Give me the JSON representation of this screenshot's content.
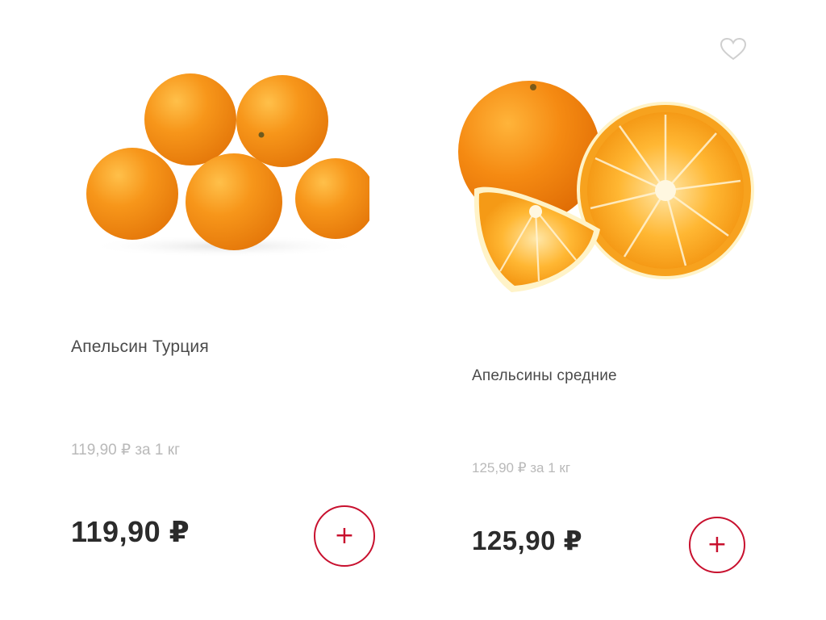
{
  "products": [
    {
      "name": "Апельсин Турция",
      "unit_price": "119,90 ₽ за 1 кг",
      "price": "119,90 ₽",
      "image_icon": "oranges-pile-image",
      "add_icon_glyph": "+"
    },
    {
      "name": "Апельсины средние",
      "unit_price": "125,90 ₽ за 1 кг",
      "price": "125,90 ₽",
      "image_icon": "orange-halves-image",
      "add_icon_glyph": "+",
      "favorite_icon": "heart-outline-icon"
    }
  ],
  "colors": {
    "accent": "#c8102e",
    "price_text": "#2b2b2b",
    "name_text": "#4a4a4a",
    "unit_price_text": "#b9b9b9",
    "orange_fill": "#f7941d"
  }
}
